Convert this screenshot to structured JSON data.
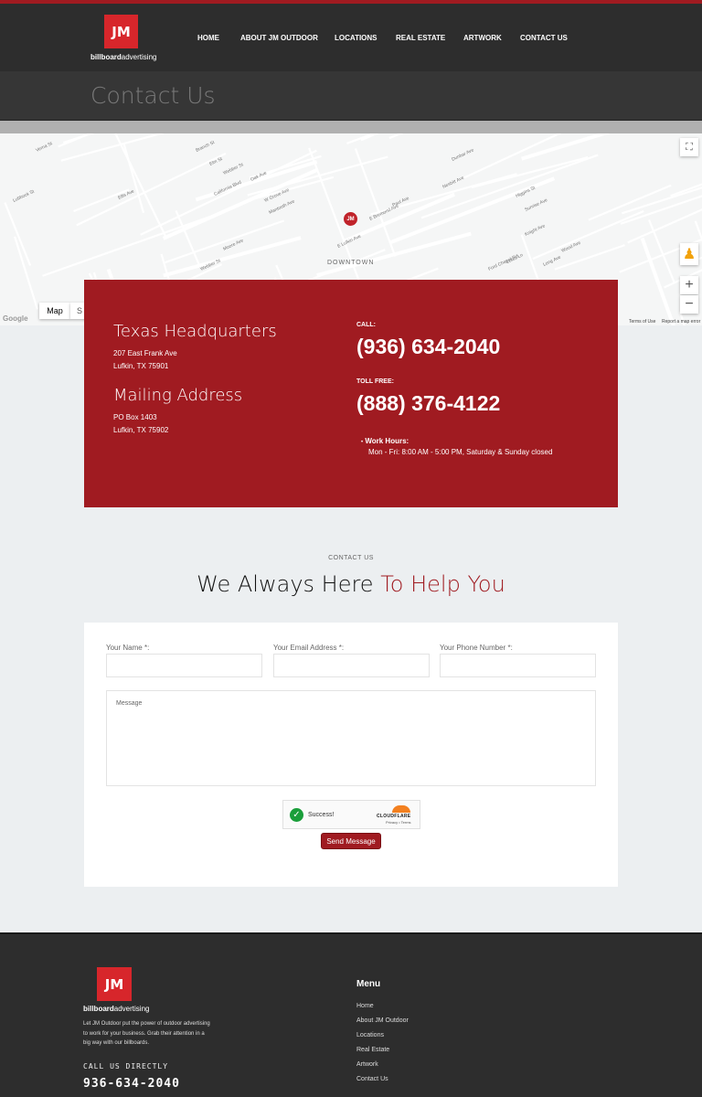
{
  "header": {
    "logo_text": "JM",
    "logo_sub_bold": "billboard",
    "logo_sub_light": "advertising",
    "nav": [
      "HOME",
      "ABOUT JM OUTDOOR",
      "LOCATIONS",
      "REAL ESTATE",
      "ARTWORK",
      "CONTACT US"
    ]
  },
  "page_title": "Contact Us",
  "map": {
    "area_label": "DOWNTOWN",
    "streets": [
      "Verna St",
      "Branch St",
      "Elm St",
      "Webber St",
      "California Blvd",
      "Oak Ave",
      "W Grove Ave",
      "Mantooth Ave",
      "Moore Ave",
      "E Lufkin Ave",
      "E Bremond Ave",
      "Paul Ave",
      "Dunbar Ave",
      "Nesbitt Ave",
      "Higgins St",
      "Sunrise Ave",
      "Knight Ave",
      "Wood Ave",
      "Long Ave",
      "Ford Chapel Rd",
      "Lotus Ln",
      "Ellis Ave",
      "Webber St",
      "Lubbock St"
    ],
    "map_type_button": "Map",
    "satellite_button": "S",
    "google": "Google",
    "terms": "Terms of Use",
    "report": "Report a map error",
    "zoom_in": "+",
    "zoom_out": "−",
    "marker_text": "JM"
  },
  "contact": {
    "hq_title": "Texas Headquarters",
    "hq_line1": "207 East Frank Ave",
    "hq_line2": "Lufkin, TX 75901",
    "mail_title": "Mailing Address",
    "mail_line1": "PO Box 1403",
    "mail_line2": "Lufkin, TX 75902",
    "call_label": "CALL:",
    "call_number": "(936) 634-2040",
    "toll_label": "TOLL FREE:",
    "toll_number": "(888) 376-4122",
    "hours_label": "Work Hours:",
    "hours_value": "Mon - Fri: 8:00 AM - 5:00 PM, Saturday & Sunday closed"
  },
  "section": {
    "eyebrow": "CONTACT US",
    "heading_dark": "We Always Here ",
    "heading_red": "To Help You"
  },
  "form": {
    "name_label": "Your Name",
    "email_label": "Your Email Address",
    "phone_label": "Your Phone Number",
    "required": "*",
    "message_placeholder": "Message",
    "captcha_status": "Success!",
    "captcha_brand": "CLOUDFLARE",
    "captcha_links": "Privacy • Terms",
    "send_label": "Send Message"
  },
  "footer": {
    "blurb": "Let JM Outdoor put the power of outdoor advertising to work for your business. Grab their attention in a big way with our billboards.",
    "call_label": "CALL US DIRECTLY",
    "phone": "936-634-2040",
    "menu_title": "Menu",
    "menu": [
      "Home",
      "About JM Outdoor",
      "Locations",
      "Real Estate",
      "Artwork",
      "Contact Us"
    ]
  },
  "colors": {
    "brand_red": "#a01b21",
    "logo_red": "#d7262b",
    "dark": "#2d2d2d"
  }
}
